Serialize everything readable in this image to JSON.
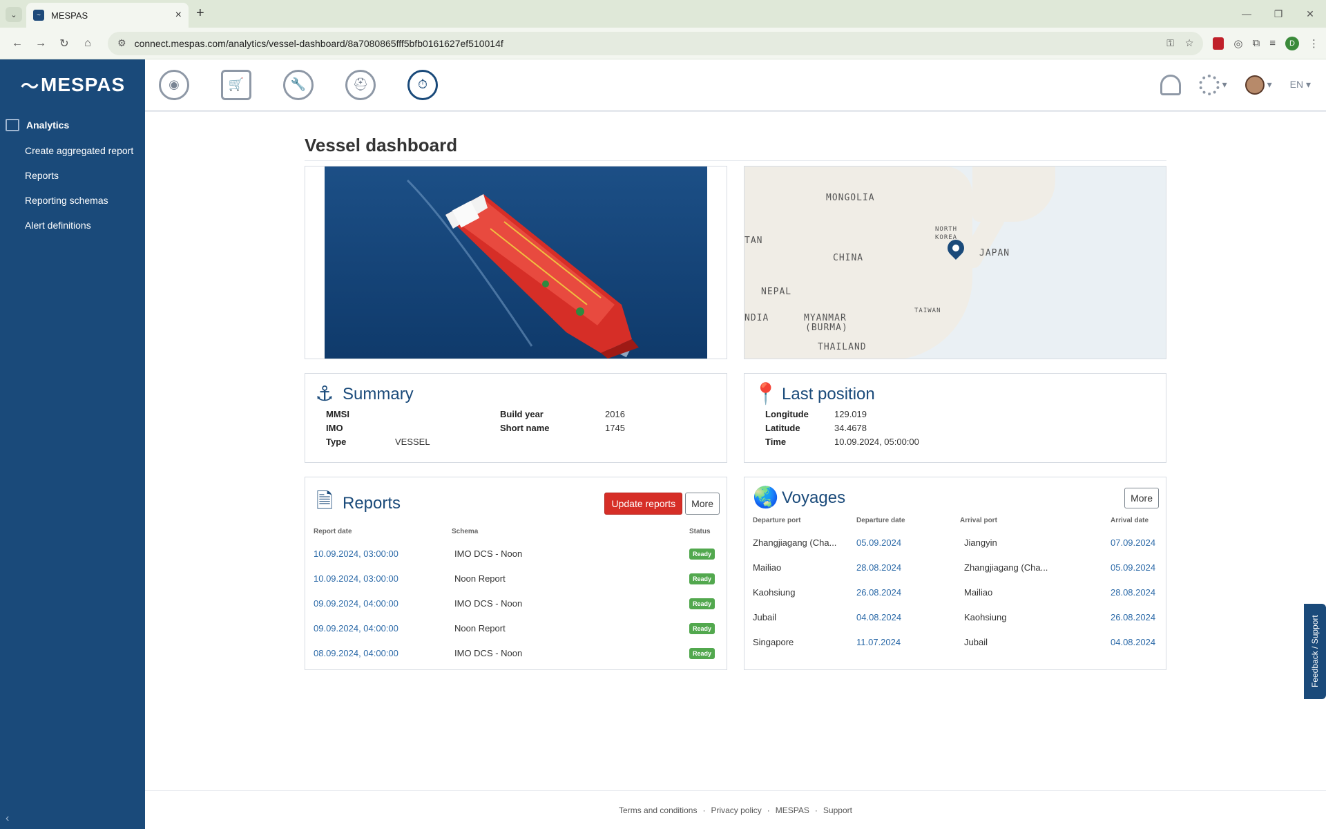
{
  "browser": {
    "tab_title": "MESPAS",
    "url": "connect.mespas.com/analytics/vessel-dashboard/8a7080865fff5bfb0161627ef510014f",
    "profile_initial": "D"
  },
  "brand": {
    "logo": "MESPAS"
  },
  "sidebar": {
    "section": "Analytics",
    "items": [
      {
        "label": "Create aggregated report"
      },
      {
        "label": "Reports"
      },
      {
        "label": "Reporting schemas"
      },
      {
        "label": "Alert definitions"
      }
    ]
  },
  "topnav": {
    "language": "EN"
  },
  "page": {
    "title": "Vessel dashboard"
  },
  "map": {
    "labels": [
      "MONGOLIA",
      "TAN",
      "CHINA",
      "NORTH",
      "KOREA",
      "JAPAN",
      "NEPAL",
      "NDIA",
      "MYANMAR",
      "(BURMA)",
      "TAIWAN",
      "THAILAND"
    ]
  },
  "summary": {
    "title": "Summary",
    "mmsi_label": "MMSI",
    "mmsi": "",
    "imo_label": "IMO",
    "imo": "",
    "type_label": "Type",
    "type": "VESSEL",
    "build_year_label": "Build year",
    "build_year": "2016",
    "short_name_label": "Short name",
    "short_name": "1745"
  },
  "last_position": {
    "title": "Last position",
    "longitude_label": "Longitude",
    "longitude": "129.019",
    "latitude_label": "Latitude",
    "latitude": "34.4678",
    "time_label": "Time",
    "time": "10.09.2024, 05:00:00"
  },
  "reports": {
    "title": "Reports",
    "update_label": "Update reports",
    "more_label": "More",
    "columns": [
      "Report date",
      "Schema",
      "Status"
    ],
    "rows": [
      {
        "date": "10.09.2024, 03:00:00",
        "schema": "IMO DCS - Noon",
        "status": "Ready"
      },
      {
        "date": "10.09.2024, 03:00:00",
        "schema": "Noon Report",
        "status": "Ready"
      },
      {
        "date": "09.09.2024, 04:00:00",
        "schema": "IMO DCS - Noon",
        "status": "Ready"
      },
      {
        "date": "09.09.2024, 04:00:00",
        "schema": "Noon Report",
        "status": "Ready"
      },
      {
        "date": "08.09.2024, 04:00:00",
        "schema": "IMO DCS - Noon",
        "status": "Ready"
      }
    ]
  },
  "voyages": {
    "title": "Voyages",
    "more_label": "More",
    "columns": [
      "Departure port",
      "Departure date",
      "Arrival port",
      "Arrival date"
    ],
    "rows": [
      {
        "dep_port": "Zhangjiagang (Cha...",
        "dep_date": "05.09.2024",
        "arr_port": "Jiangyin",
        "arr_date": "07.09.2024"
      },
      {
        "dep_port": "Mailiao",
        "dep_date": "28.08.2024",
        "arr_port": "Zhangjiagang (Cha...",
        "arr_date": "05.09.2024"
      },
      {
        "dep_port": "Kaohsiung",
        "dep_date": "26.08.2024",
        "arr_port": "Mailiao",
        "arr_date": "28.08.2024"
      },
      {
        "dep_port": "Jubail",
        "dep_date": "04.08.2024",
        "arr_port": "Kaohsiung",
        "arr_date": "26.08.2024"
      },
      {
        "dep_port": "Singapore",
        "dep_date": "11.07.2024",
        "arr_port": "Jubail",
        "arr_date": "04.08.2024"
      }
    ]
  },
  "footer": {
    "links": [
      "Terms and conditions",
      "Privacy policy",
      "MESPAS",
      "Support"
    ],
    "separator": "·"
  },
  "feedback_label": "Feedback / Support"
}
